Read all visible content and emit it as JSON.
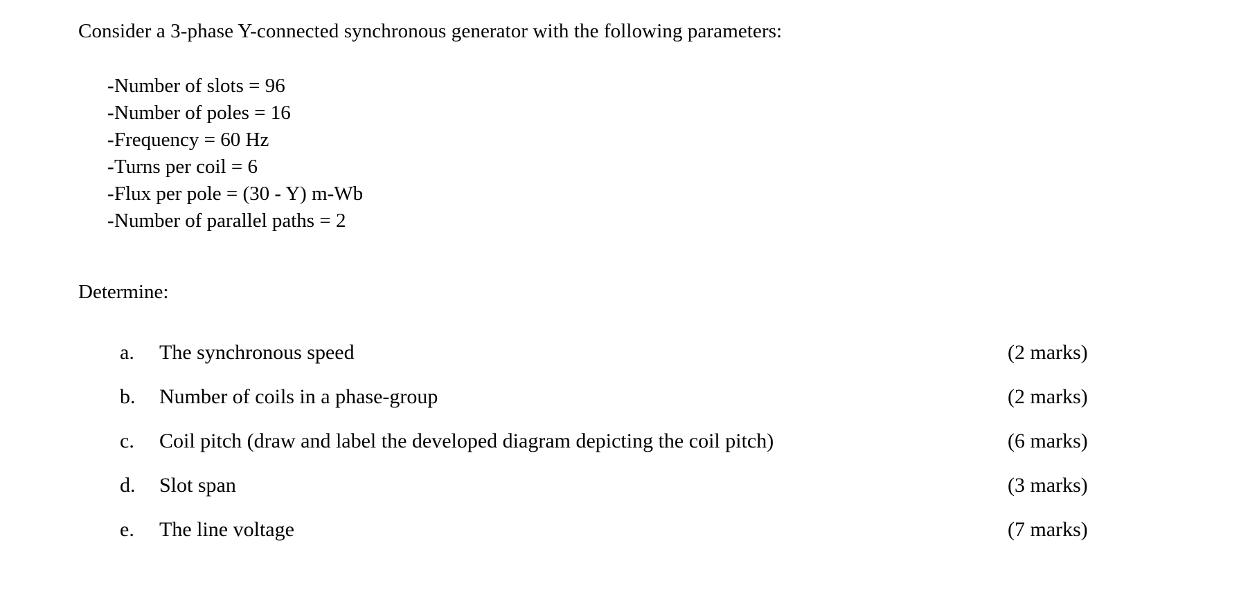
{
  "document": {
    "intro": "Consider a 3-phase Y-connected synchronous generator with the following parameters:",
    "determine_label": "Determine:",
    "bullet_marker": "-",
    "parameters": [
      {
        "label": "Number of slots = 96"
      },
      {
        "label": "Number of poles = 16"
      },
      {
        "label": "Frequency = 60 Hz"
      },
      {
        "label": "Turns per coil = 6"
      },
      {
        "label": "Flux per pole = (30 - Y) m-Wb"
      },
      {
        "label": "Number of parallel paths = 2"
      }
    ],
    "questions": [
      {
        "marker": "a.",
        "text": "The synchronous speed",
        "marks": "(2 marks)"
      },
      {
        "marker": "b.",
        "text": "Number of coils in a phase-group",
        "marks": "(2 marks)"
      },
      {
        "marker": "c.",
        "text": "Coil pitch (draw and label the developed diagram depicting the coil pitch)",
        "marks": "(6 marks)"
      },
      {
        "marker": "d.",
        "text": "Slot span",
        "marks": "(3 marks)"
      },
      {
        "marker": "e.",
        "text": "The line voltage",
        "marks": "(7 marks)"
      }
    ]
  }
}
